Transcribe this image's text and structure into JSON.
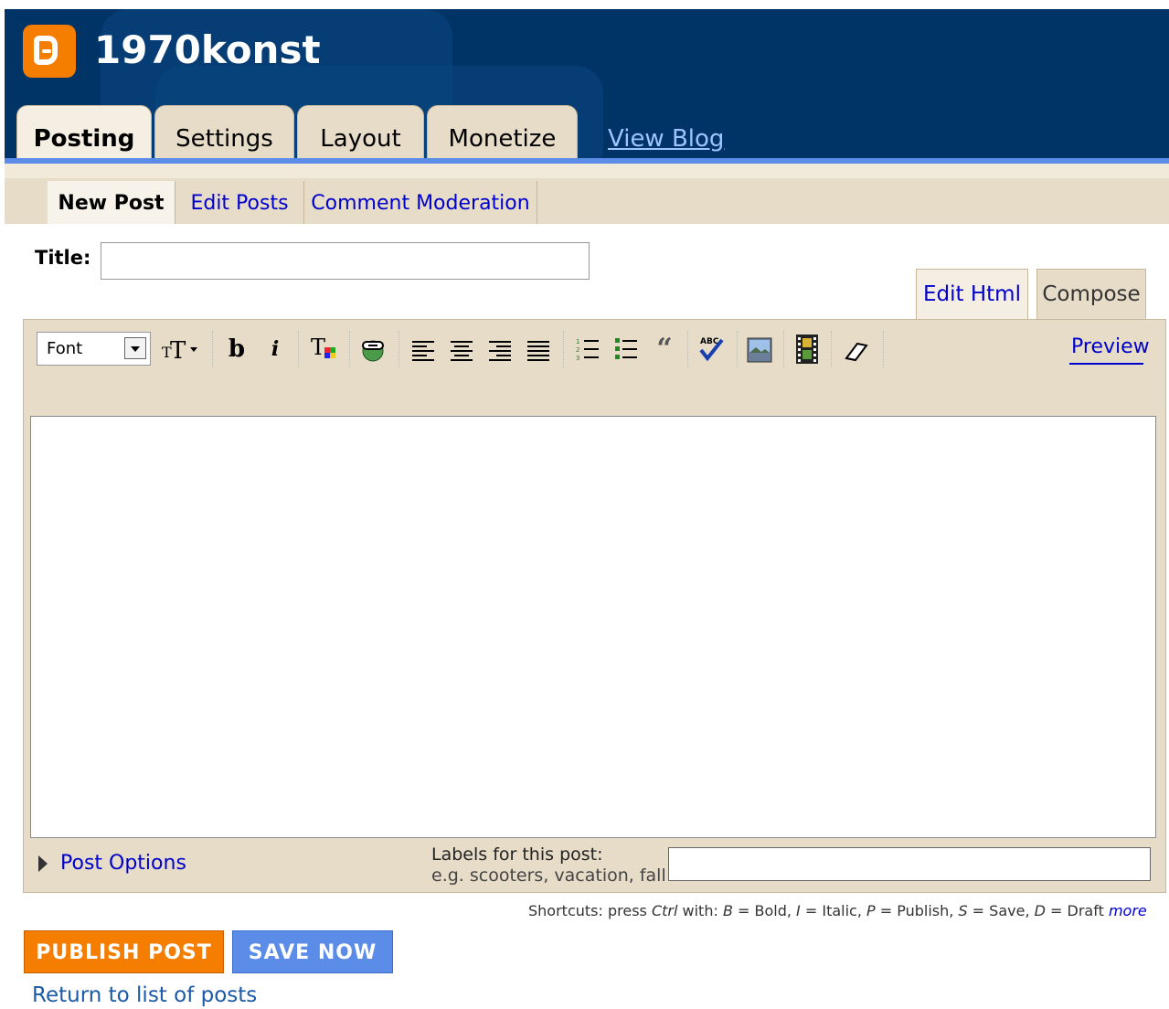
{
  "header": {
    "blog_name": "1970konst",
    "tabs": [
      {
        "label": "Posting"
      },
      {
        "label": "Settings"
      },
      {
        "label": "Layout"
      },
      {
        "label": "Monetize"
      }
    ],
    "view_blog": "View Blog"
  },
  "subnav": {
    "items": [
      {
        "label": "New Post"
      },
      {
        "label": "Edit Posts"
      },
      {
        "label": "Comment Moderation"
      }
    ]
  },
  "post": {
    "title_label": "Title:",
    "title_value": "",
    "mode_tabs": [
      {
        "label": "Edit Html"
      },
      {
        "label": "Compose"
      }
    ]
  },
  "toolbar": {
    "font_label": "Font",
    "preview": "Preview"
  },
  "options": {
    "post_options": "Post Options",
    "labels_title": "Labels for this post:",
    "labels_example": "e.g. scooters, vacation, fall",
    "labels_value": ""
  },
  "shortcuts": {
    "prefix": "Shortcuts: press ",
    "ctrl": "Ctrl",
    "with": " with: ",
    "b_key": "B",
    "b_desc": " = Bold, ",
    "i_key": "I",
    "i_desc": " = Italic, ",
    "p_key": "P",
    "p_desc": " = Publish, ",
    "s_key": "S",
    "s_desc": " = Save, ",
    "d_key": "D",
    "d_desc": " = Draft ",
    "more": "more"
  },
  "actions": {
    "publish": "PUBLISH POST",
    "save": "SAVE NOW",
    "return": "Return to list of posts"
  },
  "colors": {
    "header_bg": "#003366",
    "publish": "#f57d00",
    "save": "#5a8ce8"
  }
}
